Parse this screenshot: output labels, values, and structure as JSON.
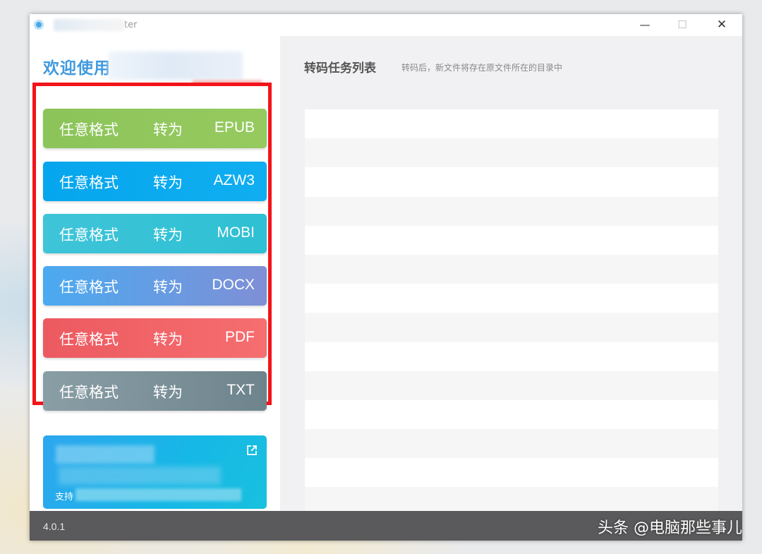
{
  "window": {
    "title_visible": "ter",
    "controls": {
      "minimize": "—",
      "maximize": "☐",
      "close": "✕"
    }
  },
  "sidebar": {
    "welcome": "欢迎使用",
    "buttons": [
      {
        "from": "任意格式",
        "verb": "转为",
        "format": "EPUB",
        "color_start": "#8cc45a",
        "color_end": "#96ca5f"
      },
      {
        "from": "任意格式",
        "verb": "转为",
        "format": "AZW3",
        "color_start": "#06a6ee",
        "color_end": "#10aef0"
      },
      {
        "from": "任意格式",
        "verb": "转为",
        "format": "MOBI",
        "color_start": "#3fc4d8",
        "color_end": "#2ec0d4"
      },
      {
        "from": "任意格式",
        "verb": "转为",
        "format": "DOCX",
        "color_start": "#4baaf0",
        "color_end": "#7f8fd6"
      },
      {
        "from": "任意格式",
        "verb": "转为",
        "format": "PDF",
        "color_start": "#ec5a60",
        "color_end": "#f66e70"
      },
      {
        "from": "任意格式",
        "verb": "转为",
        "format": "TXT",
        "color_start": "#8a9ea6",
        "color_end": "#6e848c"
      }
    ],
    "promo": {
      "text": "支持",
      "icon": "external-link-icon"
    },
    "highlight_color": "#f2141a"
  },
  "main": {
    "title": "转码任务列表",
    "subtitle": "转码后，新文件将存在原文件所在的目录中"
  },
  "footer": {
    "version": "4.0.1",
    "watermark": "头条 @电脑那些事儿"
  }
}
